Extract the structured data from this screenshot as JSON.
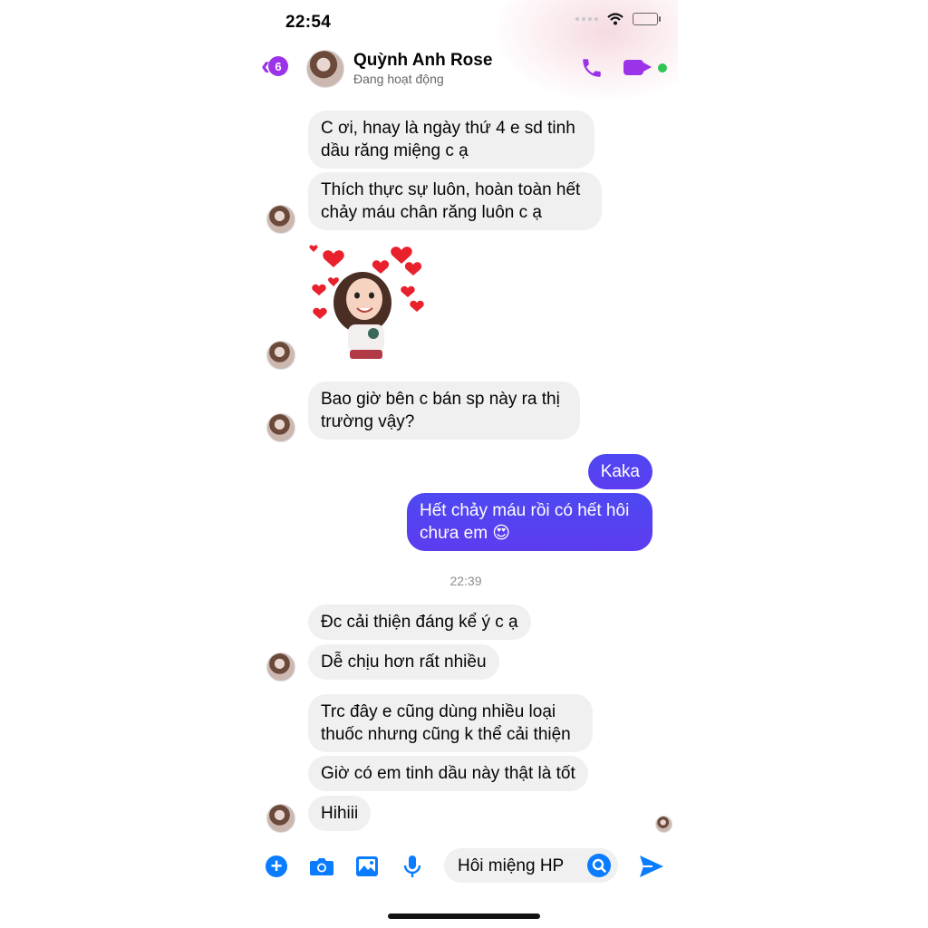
{
  "status_bar": {
    "time": "22:54"
  },
  "header": {
    "back_count": "6",
    "contact_name": "Quỳnh Anh Rose",
    "contact_status": "Đang hoạt động"
  },
  "messages": {
    "m1": "C ơi, hnay là ngày thứ 4 e sd tinh dầu răng miệng c ạ",
    "m2": "Thích thực sự luôn, hoàn toàn hết chảy máu chân răng luôn c ạ",
    "m3": "Bao giờ bên c bán sp này ra thị trường vậy?",
    "m4": "Kaka",
    "m5": "Hết chảy máu rồi có hết hôi chưa em 😍",
    "timestamp": "22:39",
    "m6": "Đc cải thiện đáng kể ý c ạ",
    "m7": "Dễ chịu hơn rất nhiều",
    "m8": "Trc đây e cũng dùng nhiều loại thuốc nhưng cũng k thể cải thiện",
    "m9": "Giờ có em tinh dầu này thật là tốt",
    "m10": "Hihiii"
  },
  "composer": {
    "input_value": "Hôi miệng HP"
  },
  "colors": {
    "accent": "#9b34e8",
    "outgoing": "#5b3af0",
    "incoming": "#f0f0f0",
    "icon_blue": "#0a7cff"
  }
}
